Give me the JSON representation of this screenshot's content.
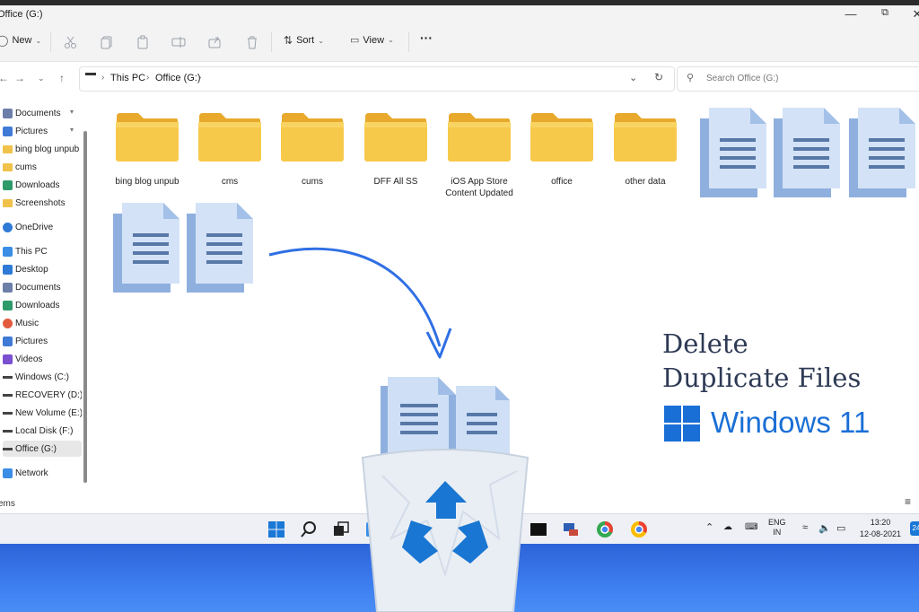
{
  "window": {
    "title": "Office (G:)"
  },
  "toolbar": {
    "new_label": "New",
    "sort_label": "Sort",
    "view_label": "View",
    "more_label": "···"
  },
  "address": {
    "crumbs": [
      "This PC",
      "Office (G:)"
    ],
    "search_placeholder": "Search Office (G:)"
  },
  "sidebar": {
    "items": [
      {
        "label": "Documents",
        "icon": "documents-icon",
        "pinned": true
      },
      {
        "label": "Pictures",
        "icon": "pictures-icon",
        "pinned": true
      },
      {
        "label": "bing blog unpub",
        "icon": "folder-icon"
      },
      {
        "label": "cums",
        "icon": "folder-icon"
      },
      {
        "label": "Downloads",
        "icon": "downloads-icon"
      },
      {
        "label": "Screenshots",
        "icon": "folder-icon"
      },
      {
        "label": "OneDrive",
        "icon": "cloud-icon"
      },
      {
        "label": "This PC",
        "icon": "pc-icon"
      },
      {
        "label": "Desktop",
        "icon": "desktop-icon"
      },
      {
        "label": "Documents",
        "icon": "documents-icon"
      },
      {
        "label": "Downloads",
        "icon": "downloads-icon"
      },
      {
        "label": "Music",
        "icon": "music-icon"
      },
      {
        "label": "Pictures",
        "icon": "pictures-icon"
      },
      {
        "label": "Videos",
        "icon": "videos-icon"
      },
      {
        "label": "Windows (C:)",
        "icon": "drive-icon"
      },
      {
        "label": "RECOVERY (D:)",
        "icon": "drive-icon"
      },
      {
        "label": "New Volume (E:)",
        "icon": "drive-icon"
      },
      {
        "label": "Local Disk (F:)",
        "icon": "drive-icon"
      },
      {
        "label": "Office (G:)",
        "icon": "drive-icon",
        "selected": true
      },
      {
        "label": "Network",
        "icon": "network-icon"
      }
    ]
  },
  "content": {
    "folders": [
      {
        "name": "bing blog unpub"
      },
      {
        "name": "cms"
      },
      {
        "name": "cums"
      },
      {
        "name": "DFF All SS"
      },
      {
        "name": "iOS App Store Content Updated"
      },
      {
        "name": "office"
      },
      {
        "name": "other data"
      }
    ]
  },
  "status": {
    "items_text": "ems"
  },
  "promo": {
    "line1": "Delete",
    "line2": "Duplicate Files",
    "brand": "Windows 11",
    "accent_color": "#1a6fd6"
  },
  "tray": {
    "lang_1": "ENG",
    "lang_2": "IN",
    "time": "13:20",
    "date": "12-08-2021",
    "badge": "24"
  }
}
